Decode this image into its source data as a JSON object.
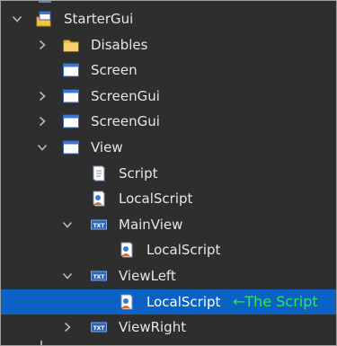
{
  "explorer": {
    "items": [
      {
        "name": "starter-gui",
        "label": "StarterGui",
        "icon": "starter-gui-icon",
        "chevron": "down",
        "depth": 0
      },
      {
        "name": "disables",
        "label": "Disables",
        "icon": "folder-icon",
        "chevron": "right",
        "depth": 1
      },
      {
        "name": "screen",
        "label": "Screen",
        "icon": "screen-gui-icon",
        "chevron": "none",
        "depth": 1
      },
      {
        "name": "screen-gui-1",
        "label": "ScreenGui",
        "icon": "screen-gui-icon",
        "chevron": "right",
        "depth": 1
      },
      {
        "name": "screen-gui-2",
        "label": "ScreenGui",
        "icon": "screen-gui-icon",
        "chevron": "right",
        "depth": 1
      },
      {
        "name": "view",
        "label": "View",
        "icon": "screen-gui-icon",
        "chevron": "down",
        "depth": 1
      },
      {
        "name": "script",
        "label": "Script",
        "icon": "script-icon",
        "chevron": "none",
        "depth": 2
      },
      {
        "name": "local-script-1",
        "label": "LocalScript",
        "icon": "local-script-icon",
        "chevron": "none",
        "depth": 2
      },
      {
        "name": "main-view",
        "label": "MainView",
        "icon": "text-label-icon",
        "chevron": "down",
        "depth": 2
      },
      {
        "name": "local-script-2",
        "label": "LocalScript",
        "icon": "local-script-icon",
        "chevron": "none",
        "depth": 3
      },
      {
        "name": "view-left",
        "label": "ViewLeft",
        "icon": "text-label-icon",
        "chevron": "down",
        "depth": 2
      },
      {
        "name": "local-script-3",
        "label": "LocalScript",
        "icon": "local-script-icon",
        "chevron": "none",
        "depth": 3,
        "selected": true
      },
      {
        "name": "view-right",
        "label": "ViewRight",
        "icon": "text-label-icon",
        "chevron": "right",
        "depth": 2
      }
    ],
    "annotation": "←The Script",
    "colors": {
      "background": "#2e2e2e",
      "selected": "#0b62c4",
      "text": "#e6e6e6",
      "annotation": "#2ee84f"
    }
  }
}
